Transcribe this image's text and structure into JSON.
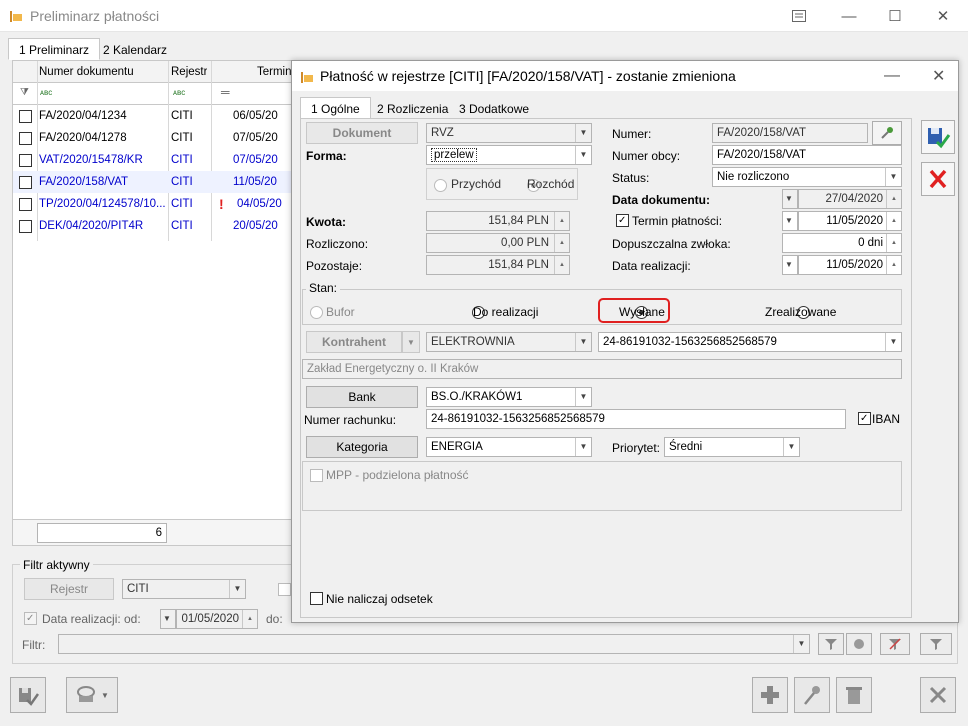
{
  "window": {
    "title": "Preliminarz płatności"
  },
  "tabs": [
    {
      "label": "1 Preliminarz"
    },
    {
      "label": "2 Kalendarz"
    }
  ],
  "grid": {
    "columns": [
      "Numer dokumentu",
      "Rejestr",
      "Termin"
    ],
    "rows": [
      {
        "number": "FA/2020/04/1234",
        "register": "CITI",
        "date": "06/05/20",
        "color": "black"
      },
      {
        "number": "FA/2020/04/1278",
        "register": "CITI",
        "date": "07/05/20",
        "color": "black"
      },
      {
        "number": "VAT/2020/15478/KR",
        "register": "CITI",
        "date": "07/05/20",
        "color": "blue"
      },
      {
        "number": "FA/2020/158/VAT",
        "register": "CITI",
        "date": "11/05/20",
        "color": "blue"
      },
      {
        "number": "TP/2020/04/124578/10...",
        "register": "CITI",
        "date": "04/05/20",
        "color": "blue",
        "flag": "!"
      },
      {
        "number": "DEK/04/2020/PIT4R",
        "register": "CITI",
        "date": "20/05/20",
        "color": "blue"
      }
    ],
    "count": "6"
  },
  "filter": {
    "title": "Filtr aktywny",
    "register_btn": "Rejestr",
    "register_value": "CITI",
    "realization_label": "Data realizacji:",
    "from_label": "od:",
    "from_value": "01/05/2020",
    "to_label": "do:",
    "filter_label": "Filtr:"
  },
  "dialog": {
    "title": "Płatność w rejestrze [CITI] [FA/2020/158/VAT] - zostanie zmieniona",
    "tabs": [
      {
        "label": "1 Ogólne"
      },
      {
        "label": "2 Rozliczenia"
      },
      {
        "label": "3 Dodatkowe"
      }
    ],
    "document_btn": "Dokument",
    "document_value": "RVZ",
    "form_label": "Forma:",
    "form_value": "przelew",
    "income_label": "Przychód",
    "expense_label": "Rozchód",
    "amount_label": "Kwota:",
    "amount_value": "151,84 PLN",
    "settled_label": "Rozliczono:",
    "settled_value": "0,00 PLN",
    "remaining_label": "Pozostaje:",
    "remaining_value": "151,84 PLN",
    "number_label": "Numer:",
    "number_value": "FA/2020/158/VAT",
    "foreign_label": "Numer obcy:",
    "foreign_value": "FA/2020/158/VAT",
    "status_label": "Status:",
    "status_value": "Nie rozliczono",
    "docdate_label": "Data dokumentu:",
    "docdate_value": "27/04/2020",
    "due_label": "Termin płatności:",
    "due_value": "11/05/2020",
    "delay_label": "Dopuszczalna zwłoka:",
    "delay_value": "0 dni",
    "realdate_label": "Data realizacji:",
    "realdate_value": "11/05/2020",
    "state": {
      "title": "Stan:",
      "options": [
        "Bufor",
        "Do realizacji",
        "Wysłane",
        "Zrealizowane"
      ],
      "selected": "Wysłane"
    },
    "contractor_btn": "Kontrahent",
    "contractor_value": "ELEKTROWNIA",
    "contractor_account": "24-86191032-1563256852568579",
    "contractor_name": "Zakład Energetyczny o. II Kraków",
    "bank_btn": "Bank",
    "bank_value": "BS.O./KRAKÓW1",
    "account_label": "Numer rachunku:",
    "account_value": "24-86191032-1563256852568579",
    "iban_label": "IBAN",
    "category_btn": "Kategoria",
    "category_value": "ENERGIA",
    "priority_label": "Priorytet:",
    "priority_value": "Średni",
    "mpp_label": "MPP - podzielona płatność",
    "no_interest_label": "Nie naliczaj odsetek"
  },
  "colors": {
    "accent_blue": "#0000cc",
    "highlight_red": "#e02020",
    "row_selected": "#eef2ff"
  }
}
